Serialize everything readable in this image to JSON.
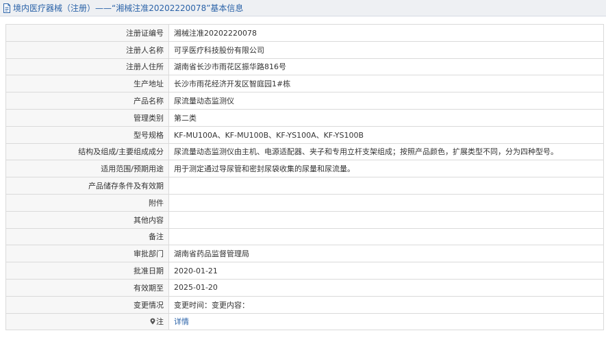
{
  "header": {
    "title": "境内医疗器械（注册）——“湘械注准20202220078”基本信息"
  },
  "fields": [
    {
      "label": "注册证编号",
      "value": "湘械注准20202220078"
    },
    {
      "label": "注册人名称",
      "value": "可孚医疗科技股份有限公司"
    },
    {
      "label": "注册人住所",
      "value": "湖南省长沙市雨花区振华路816号"
    },
    {
      "label": "生产地址",
      "value": "长沙市雨花经济开发区智庭园1#栋"
    },
    {
      "label": "产品名称",
      "value": "尿流量动态监测仪"
    },
    {
      "label": "管理类别",
      "value": "第二类"
    },
    {
      "label": "型号规格",
      "value": "KF-MU100A、KF-MU100B、KF-YS100A、KF-YS100B"
    },
    {
      "label": "结构及组成/主要组成成分",
      "value": "尿流量动态监测仪由主机、电源适配器、夹子和专用立杆支架组成；按照产品颜色，扩展类型不同，分为四种型号。"
    },
    {
      "label": "适用范围/预期用途",
      "value": "用于测定通过导尿管和密封尿袋收集的尿量和尿流量。"
    },
    {
      "label": "产品储存条件及有效期",
      "value": ""
    },
    {
      "label": "附件",
      "value": ""
    },
    {
      "label": "其他内容",
      "value": ""
    },
    {
      "label": "备注",
      "value": ""
    },
    {
      "label": "审批部门",
      "value": "湖南省药品监督管理局"
    },
    {
      "label": "批准日期",
      "value": "2020-01-21"
    },
    {
      "label": "有效期至",
      "value": "2025-01-20"
    },
    {
      "label": "变更情况",
      "value": "变更时间：变更内容："
    }
  ],
  "note": {
    "icon": "pin-icon",
    "label": "注",
    "link_text": "详情"
  },
  "colors": {
    "link": "#2a62a8",
    "header_bg": "#eef0f3",
    "border": "#dadada"
  }
}
